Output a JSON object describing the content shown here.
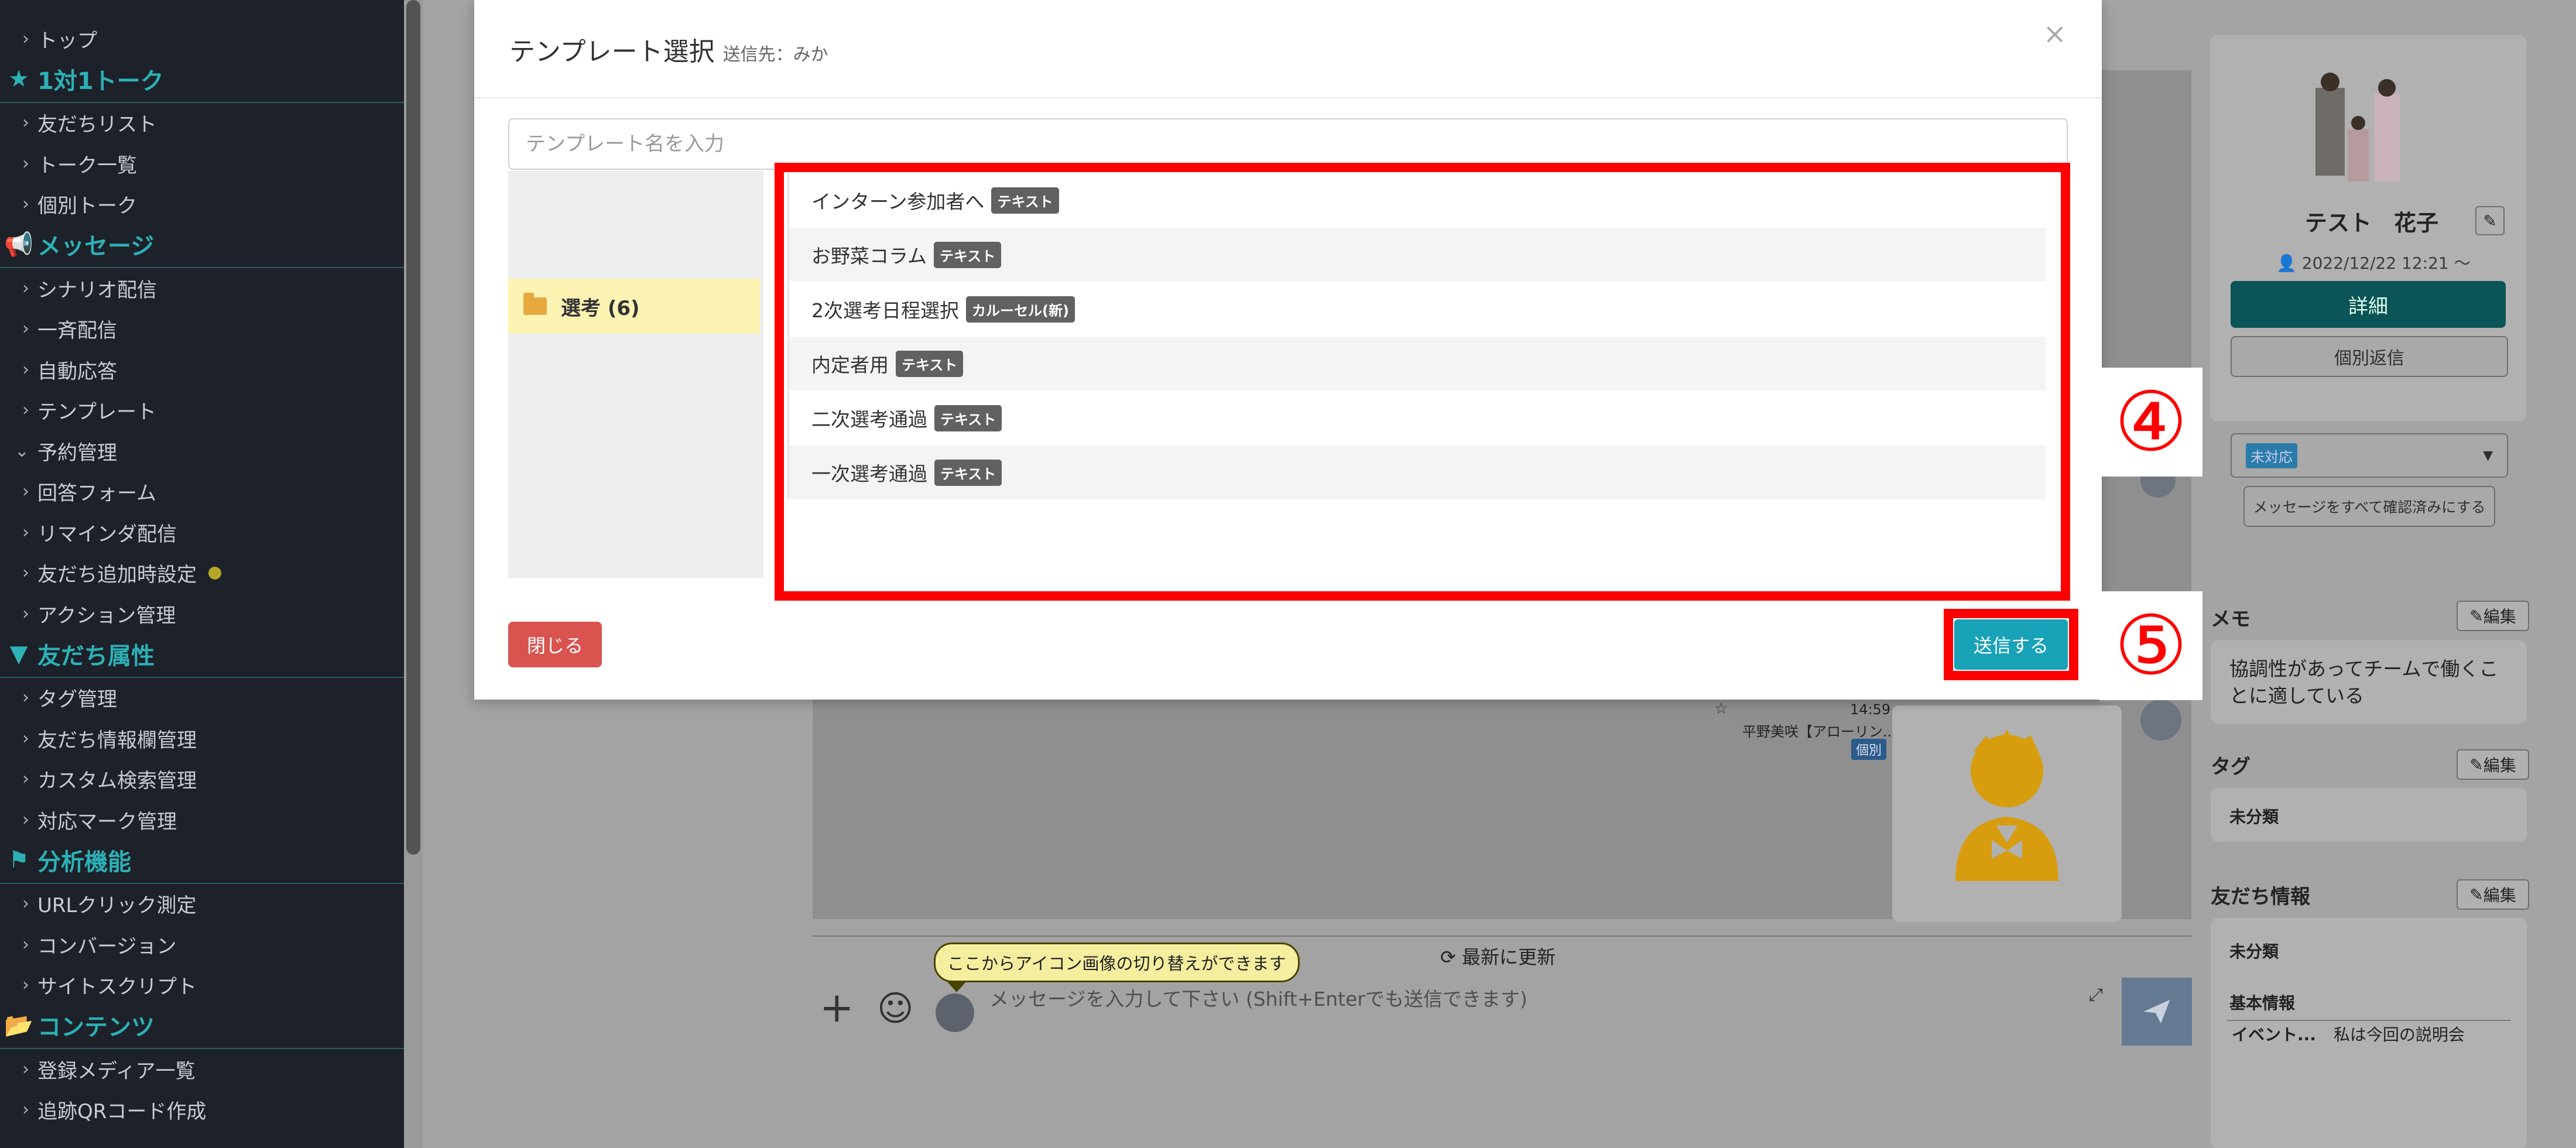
{
  "sidebar": {
    "items": [
      {
        "label": "トップ",
        "type": "item"
      },
      {
        "label": "1対1トーク",
        "type": "head",
        "icon": "star-icon"
      },
      {
        "label": "友だちリスト",
        "type": "item"
      },
      {
        "label": "トーク一覧",
        "type": "item"
      },
      {
        "label": "個別トーク",
        "type": "item"
      },
      {
        "label": "メッセージ",
        "type": "head",
        "icon": "megaphone-icon"
      },
      {
        "label": "シナリオ配信",
        "type": "item"
      },
      {
        "label": "一斉配信",
        "type": "item"
      },
      {
        "label": "自動応答",
        "type": "item"
      },
      {
        "label": "テンプレート",
        "type": "item"
      },
      {
        "label": "予約管理",
        "type": "item",
        "expanded": true
      },
      {
        "label": "回答フォーム",
        "type": "item"
      },
      {
        "label": "リマインダ配信",
        "type": "item"
      },
      {
        "label": "友だち追加時設定",
        "type": "item",
        "dot": true
      },
      {
        "label": "アクション管理",
        "type": "item"
      },
      {
        "label": "友だち属性",
        "type": "head",
        "icon": "filter-icon"
      },
      {
        "label": "タグ管理",
        "type": "item"
      },
      {
        "label": "友だち情報欄管理",
        "type": "item"
      },
      {
        "label": "カスタム検索管理",
        "type": "item"
      },
      {
        "label": "対応マーク管理",
        "type": "item"
      },
      {
        "label": "分析機能",
        "type": "head",
        "icon": "flag-icon"
      },
      {
        "label": "URLクリック測定",
        "type": "item"
      },
      {
        "label": "コンバージョン",
        "type": "item"
      },
      {
        "label": "サイトスクリプト",
        "type": "item"
      },
      {
        "label": "コンテンツ",
        "type": "head",
        "icon": "folder-icon"
      },
      {
        "label": "登録メディア一覧",
        "type": "item"
      },
      {
        "label": "追跡QRコード作成",
        "type": "item"
      }
    ]
  },
  "modal": {
    "title": "テンプレート選択",
    "recipient": "送信先：みか",
    "close_symbol": "×",
    "search_placeholder": "テンプレート名を入力",
    "folder": "選考 (6)",
    "templates": [
      {
        "name": "インターン参加者へ",
        "badge": "テキスト"
      },
      {
        "name": "お野菜コラム",
        "badge": "テキスト"
      },
      {
        "name": "2次選考日程選択",
        "badge": "カルーセル(新)"
      },
      {
        "name": "内定者用",
        "badge": "テキスト"
      },
      {
        "name": "二次選考通過",
        "badge": "テキスト"
      },
      {
        "name": "一次選考通過",
        "badge": "テキスト"
      }
    ],
    "close_button": "閉じる",
    "send_button": "送信する"
  },
  "annotations": {
    "step4": "④",
    "step5": "⑤"
  },
  "chat": {
    "time": "14:59",
    "sender": "平野美咲【アローリン...",
    "badge": "個別",
    "tooltip": "ここからアイコン画像の切り替えができます",
    "refresh": "最新に更新",
    "input_placeholder": "メッセージを入力して下さい (Shift+Enterでも送信できます)"
  },
  "profile": {
    "name": "テスト　花子",
    "date": "2022/12/22 12:21 〜",
    "detail_button": "詳細",
    "reply_button": "個別返信",
    "status_select": "未対応",
    "mark_read_button": "メッセージをすべて確認済みにする",
    "memo_title": "メモ",
    "memo_text": "協調性があってチームで働くことに適している",
    "edit_label": "編集",
    "tag_title": "タグ",
    "tag_value": "未分類",
    "friend_info_title": "友だち情報",
    "friend_info_value": "未分類",
    "basic_info": "基本情報",
    "event_key": "イベント...",
    "event_value": "私は今回の説明会"
  },
  "colors": {
    "sidebar_bg": "#1d2129",
    "accent": "#2cb1b6",
    "highlight_red": "#ff0000",
    "send_teal": "#17a2b8",
    "close_red": "#d9534f",
    "folder_yellow": "#fdf3b3"
  }
}
